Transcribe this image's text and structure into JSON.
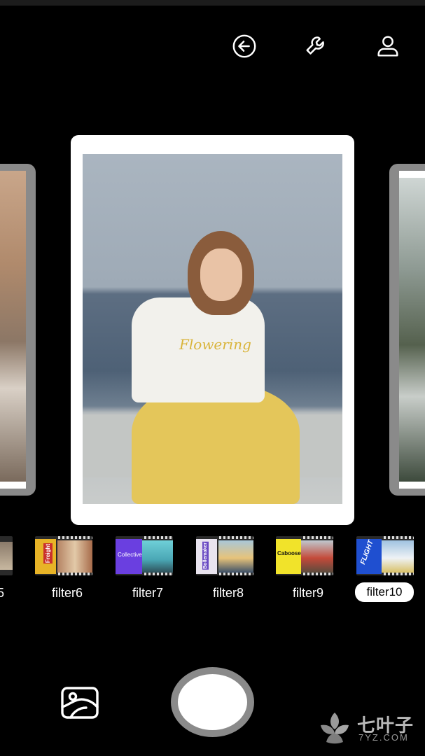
{
  "toolbar": {
    "icons": [
      "back-arrow-icon",
      "wrench-icon",
      "user-icon"
    ]
  },
  "filters": [
    {
      "label": "5",
      "can_text": ""
    },
    {
      "label": "filter6",
      "can_text": "Freight"
    },
    {
      "label": "filter7",
      "can_text": "Collective"
    },
    {
      "label": "filter8",
      "can_text": "Bollemaker"
    },
    {
      "label": "filter9",
      "can_text": "Caboose"
    },
    {
      "label": "filter10",
      "can_text": "FLIGHT",
      "selected": true
    }
  ],
  "shirt_text": "Flowering",
  "watermark": {
    "title": "七叶子",
    "subtitle": "7YZ.COM"
  },
  "colors": {
    "background": "#000000",
    "card": "#ffffff",
    "side_card": "#8a8a8a",
    "shutter_ring": "#8a8a8a"
  }
}
